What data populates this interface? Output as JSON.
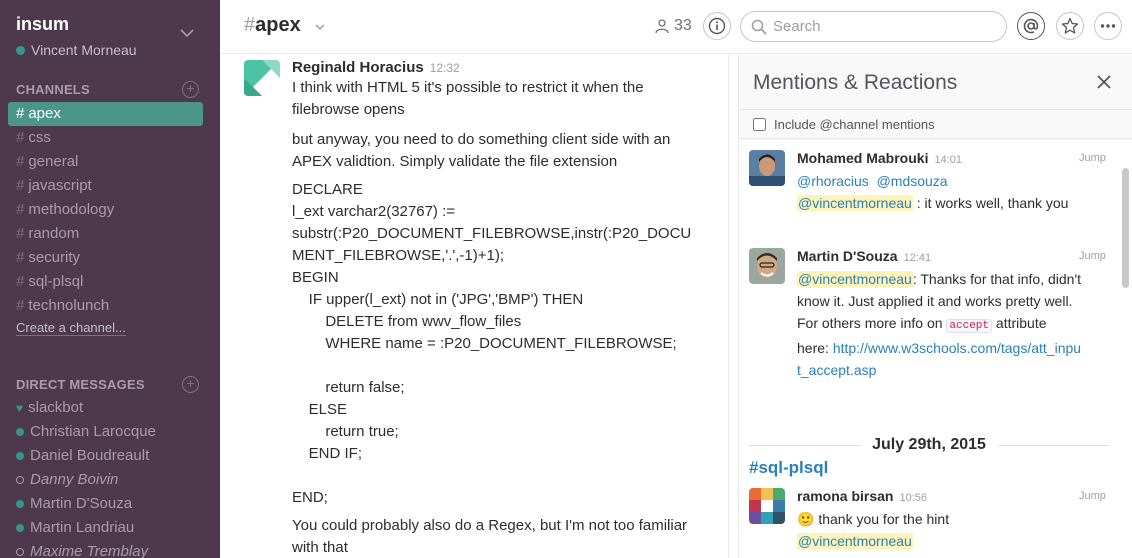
{
  "team": {
    "name": "insum",
    "user": "Vincent Morneau"
  },
  "sidebar": {
    "channels_title": "CHANNELS",
    "channels": [
      {
        "name": "apex",
        "active": true
      },
      {
        "name": "css"
      },
      {
        "name": "general"
      },
      {
        "name": "javascript"
      },
      {
        "name": "methodology"
      },
      {
        "name": "random"
      },
      {
        "name": "security"
      },
      {
        "name": "sql-plsql"
      },
      {
        "name": "technolunch"
      }
    ],
    "create_channel": "Create a channel...",
    "dm_title": "DIRECT MESSAGES",
    "dms": [
      {
        "name": "slackbot"
      },
      {
        "name": "Christian Larocque"
      },
      {
        "name": "Daniel Boudreault"
      },
      {
        "name": "Danny Boivin"
      },
      {
        "name": "Martin D'Souza"
      },
      {
        "name": "Martin Landriau"
      },
      {
        "name": "Maxime Tremblay"
      }
    ]
  },
  "header": {
    "hash": "#",
    "channel": "apex",
    "member_count": "33",
    "search_placeholder": "Search"
  },
  "message": {
    "sender": "Reginald Horacius",
    "time": "12:32",
    "p1": "I think with HTML 5 it's possible to restrict it when the filebrowse opens",
    "p2": "but anyway, you need to do something client side with an APEX validtion.  Simply validate the file extension",
    "code": [
      "DECLARE",
      "l_ext varchar2(32767) :=",
      "substr(:P20_DOCUMENT_FILEBROWSE,instr(:P20_DOCU",
      "MENT_FILEBROWSE,'.',-1)+1);",
      "BEGIN",
      "    IF upper(l_ext) not in ('JPG','BMP') THEN",
      "        DELETE from wwv_flow_files",
      "        WHERE name = :P20_DOCUMENT_FILEBROWSE;",
      "",
      "        return false;",
      "    ELSE",
      "        return true;",
      "    END IF;",
      "",
      "END;"
    ],
    "p3": "You could probably also do a Regex, but I'm not too familiar with that"
  },
  "panel": {
    "title": "Mentions & Reactions",
    "include_label": "Include @channel mentions",
    "jump": "Jump",
    "items": [
      {
        "sender": "Mohamed Mabrouki",
        "time": "14:01",
        "mention1": "@rhoracius",
        "mention2": "@mdsouza",
        "mention3": "@vincentmorneau",
        "text": " : it works well, thank you"
      },
      {
        "sender": "Martin D'Souza",
        "time": "12:41",
        "mention": "@vincentmorneau",
        "text1": ": Thanks for that info, didn't know it. Just applied it and works pretty well. For others more info on ",
        "code": "accept",
        "text2": " attribute here: ",
        "link": "http://www.w3schools.com/tags/att_input_accept.asp"
      }
    ],
    "date_divider": "July 29th, 2015",
    "channel_link": "#sql-plsql",
    "item3": {
      "sender": "ramona birsan",
      "time": "10:56",
      "emoji": "🙂",
      "text": " thank you for the hint",
      "mention": "@vincentmorneau"
    }
  },
  "colors": {
    "sidebar": "#4d394b",
    "active": "#4c9689",
    "mention_bg": "#fff3b8",
    "link": "#2a80b9"
  }
}
